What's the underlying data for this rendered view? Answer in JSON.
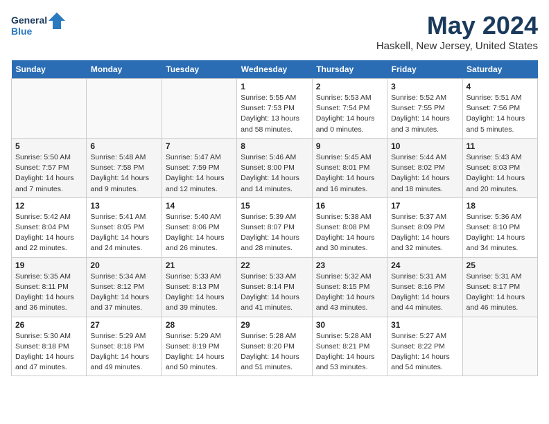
{
  "header": {
    "logo_line1": "General",
    "logo_line2": "Blue",
    "main_title": "May 2024",
    "subtitle": "Haskell, New Jersey, United States"
  },
  "weekdays": [
    "Sunday",
    "Monday",
    "Tuesday",
    "Wednesday",
    "Thursday",
    "Friday",
    "Saturday"
  ],
  "weeks": [
    [
      {
        "day": "",
        "info": ""
      },
      {
        "day": "",
        "info": ""
      },
      {
        "day": "",
        "info": ""
      },
      {
        "day": "1",
        "info": "Sunrise: 5:55 AM\nSunset: 7:53 PM\nDaylight: 13 hours\nand 58 minutes."
      },
      {
        "day": "2",
        "info": "Sunrise: 5:53 AM\nSunset: 7:54 PM\nDaylight: 14 hours\nand 0 minutes."
      },
      {
        "day": "3",
        "info": "Sunrise: 5:52 AM\nSunset: 7:55 PM\nDaylight: 14 hours\nand 3 minutes."
      },
      {
        "day": "4",
        "info": "Sunrise: 5:51 AM\nSunset: 7:56 PM\nDaylight: 14 hours\nand 5 minutes."
      }
    ],
    [
      {
        "day": "5",
        "info": "Sunrise: 5:50 AM\nSunset: 7:57 PM\nDaylight: 14 hours\nand 7 minutes."
      },
      {
        "day": "6",
        "info": "Sunrise: 5:48 AM\nSunset: 7:58 PM\nDaylight: 14 hours\nand 9 minutes."
      },
      {
        "day": "7",
        "info": "Sunrise: 5:47 AM\nSunset: 7:59 PM\nDaylight: 14 hours\nand 12 minutes."
      },
      {
        "day": "8",
        "info": "Sunrise: 5:46 AM\nSunset: 8:00 PM\nDaylight: 14 hours\nand 14 minutes."
      },
      {
        "day": "9",
        "info": "Sunrise: 5:45 AM\nSunset: 8:01 PM\nDaylight: 14 hours\nand 16 minutes."
      },
      {
        "day": "10",
        "info": "Sunrise: 5:44 AM\nSunset: 8:02 PM\nDaylight: 14 hours\nand 18 minutes."
      },
      {
        "day": "11",
        "info": "Sunrise: 5:43 AM\nSunset: 8:03 PM\nDaylight: 14 hours\nand 20 minutes."
      }
    ],
    [
      {
        "day": "12",
        "info": "Sunrise: 5:42 AM\nSunset: 8:04 PM\nDaylight: 14 hours\nand 22 minutes."
      },
      {
        "day": "13",
        "info": "Sunrise: 5:41 AM\nSunset: 8:05 PM\nDaylight: 14 hours\nand 24 minutes."
      },
      {
        "day": "14",
        "info": "Sunrise: 5:40 AM\nSunset: 8:06 PM\nDaylight: 14 hours\nand 26 minutes."
      },
      {
        "day": "15",
        "info": "Sunrise: 5:39 AM\nSunset: 8:07 PM\nDaylight: 14 hours\nand 28 minutes."
      },
      {
        "day": "16",
        "info": "Sunrise: 5:38 AM\nSunset: 8:08 PM\nDaylight: 14 hours\nand 30 minutes."
      },
      {
        "day": "17",
        "info": "Sunrise: 5:37 AM\nSunset: 8:09 PM\nDaylight: 14 hours\nand 32 minutes."
      },
      {
        "day": "18",
        "info": "Sunrise: 5:36 AM\nSunset: 8:10 PM\nDaylight: 14 hours\nand 34 minutes."
      }
    ],
    [
      {
        "day": "19",
        "info": "Sunrise: 5:35 AM\nSunset: 8:11 PM\nDaylight: 14 hours\nand 36 minutes."
      },
      {
        "day": "20",
        "info": "Sunrise: 5:34 AM\nSunset: 8:12 PM\nDaylight: 14 hours\nand 37 minutes."
      },
      {
        "day": "21",
        "info": "Sunrise: 5:33 AM\nSunset: 8:13 PM\nDaylight: 14 hours\nand 39 minutes."
      },
      {
        "day": "22",
        "info": "Sunrise: 5:33 AM\nSunset: 8:14 PM\nDaylight: 14 hours\nand 41 minutes."
      },
      {
        "day": "23",
        "info": "Sunrise: 5:32 AM\nSunset: 8:15 PM\nDaylight: 14 hours\nand 43 minutes."
      },
      {
        "day": "24",
        "info": "Sunrise: 5:31 AM\nSunset: 8:16 PM\nDaylight: 14 hours\nand 44 minutes."
      },
      {
        "day": "25",
        "info": "Sunrise: 5:31 AM\nSunset: 8:17 PM\nDaylight: 14 hours\nand 46 minutes."
      }
    ],
    [
      {
        "day": "26",
        "info": "Sunrise: 5:30 AM\nSunset: 8:18 PM\nDaylight: 14 hours\nand 47 minutes."
      },
      {
        "day": "27",
        "info": "Sunrise: 5:29 AM\nSunset: 8:18 PM\nDaylight: 14 hours\nand 49 minutes."
      },
      {
        "day": "28",
        "info": "Sunrise: 5:29 AM\nSunset: 8:19 PM\nDaylight: 14 hours\nand 50 minutes."
      },
      {
        "day": "29",
        "info": "Sunrise: 5:28 AM\nSunset: 8:20 PM\nDaylight: 14 hours\nand 51 minutes."
      },
      {
        "day": "30",
        "info": "Sunrise: 5:28 AM\nSunset: 8:21 PM\nDaylight: 14 hours\nand 53 minutes."
      },
      {
        "day": "31",
        "info": "Sunrise: 5:27 AM\nSunset: 8:22 PM\nDaylight: 14 hours\nand 54 minutes."
      },
      {
        "day": "",
        "info": ""
      }
    ]
  ]
}
